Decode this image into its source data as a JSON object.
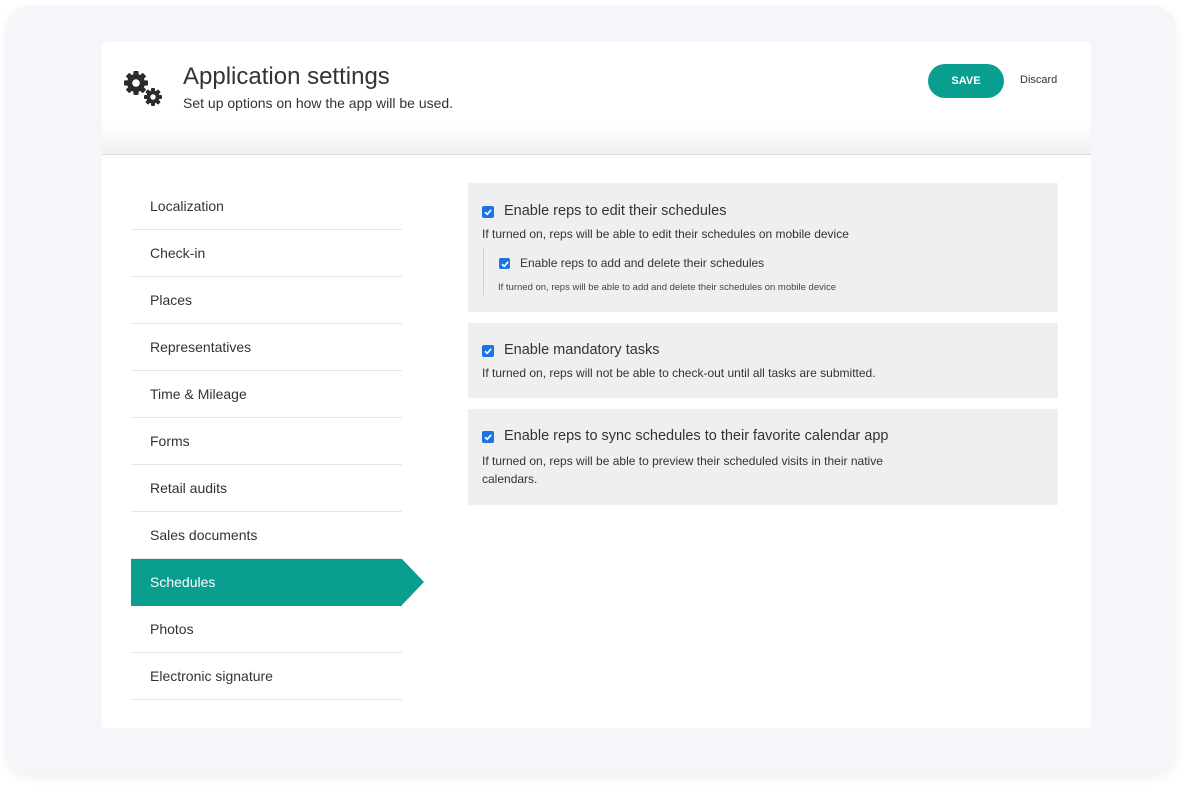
{
  "header": {
    "title": "Application settings",
    "subtitle": "Set up options on how the app will be used.",
    "save_label": "SAVE",
    "discard_label": "Discard",
    "icon": "gears-icon"
  },
  "sidebar": {
    "items": [
      {
        "label": "Localization",
        "active": false
      },
      {
        "label": "Check-in",
        "active": false
      },
      {
        "label": "Places",
        "active": false
      },
      {
        "label": "Representatives",
        "active": false
      },
      {
        "label": "Time & Mileage",
        "active": false
      },
      {
        "label": "Forms",
        "active": false
      },
      {
        "label": "Retail audits",
        "active": false
      },
      {
        "label": "Sales documents",
        "active": false
      },
      {
        "label": "Schedules",
        "active": true
      },
      {
        "label": "Photos",
        "active": false
      },
      {
        "label": "Electronic signature",
        "active": false
      }
    ]
  },
  "settings": {
    "edit_schedules": {
      "label": "Enable reps to edit their schedules",
      "description": "If turned on, reps will be able to edit their schedules on mobile device",
      "checked": true,
      "sub_option": {
        "label": "Enable reps to add and delete their schedules",
        "description": "If turned on, reps will be able to add and delete their schedules on mobile device",
        "checked": true
      }
    },
    "mandatory_tasks": {
      "label": "Enable mandatory tasks",
      "description": "If turned on, reps will not be able to check-out until all tasks are submitted.",
      "checked": true
    },
    "sync_calendar": {
      "label": "Enable reps to sync schedules to their favorite calendar app",
      "description_line1": "If turned on, reps will be able to preview their scheduled visits in their native",
      "description_line2": "calendars.",
      "checked": true
    }
  },
  "colors": {
    "accent": "#0a9e8e",
    "checkbox": "#1a73e8",
    "panel_bg": "#efefef",
    "page_bg": "#f4f6fa"
  }
}
